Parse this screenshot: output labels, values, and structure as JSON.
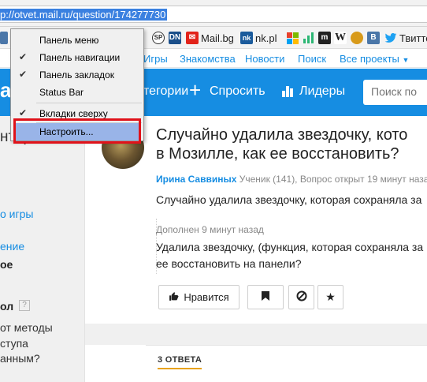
{
  "browser": {
    "url": "p://otvet.mail.ru/question/174277730"
  },
  "bookmarks": [
    {
      "icon": "sp-icon",
      "text": "SP",
      "color": "#333333"
    },
    {
      "icon": "dn-icon",
      "text": "DN",
      "color": "#1b4f8a"
    },
    {
      "icon": "mailbg-icon",
      "label": "Mail.bg",
      "color": "#e2231a"
    },
    {
      "icon": "nk-icon",
      "label": "nk.pl",
      "color": "#1b5b9c"
    },
    {
      "icon": "windows-icon",
      "color": "#e8412c"
    },
    {
      "icon": "m-icon",
      "text": "m",
      "color": "#222222"
    },
    {
      "icon": "wikipedia-icon",
      "text": "W",
      "color": "#444444"
    },
    {
      "icon": "coins-icon",
      "color": "#d89a1a"
    },
    {
      "icon": "vk-icon",
      "text": "B",
      "color": "#4a76a8"
    },
    {
      "icon": "twitter-icon",
      "label": "Твитте",
      "color": "#1da1f2"
    }
  ],
  "topnav": {
    "items": [
      "Игры",
      "Знакомства",
      "Новости",
      "Поиск",
      "Все проекты"
    ]
  },
  "header": {
    "categories": "тегории",
    "ask": "Спросить",
    "leaders": "Лидеры",
    "search_placeholder": "Поиск по"
  },
  "sidebar": {
    "line1": "нтересно?",
    "line2": "о игры",
    "line3": "ение",
    "line4": "ое",
    "line5": "ол",
    "line6": "от методы",
    "line7": "ступа",
    "line8": "анным?"
  },
  "question": {
    "title_line1": "Случайно удалила звездочку, кото",
    "title_line2": "в Мозилле, как ее восстановить?",
    "author": "Ирина Саввиных",
    "meta": " Ученик (141), Вопрос открыт 19 минут наза",
    "body": "Случайно удалила звездочку, которая сохраняла за",
    "added_label": "Дополнен 9 минут назад",
    "added_line1": "Удалила звездочку, (функция, которая сохраняла за",
    "added_line2": "ее восстановить на панели?"
  },
  "actions": {
    "like": "Нравится"
  },
  "answers": {
    "count_label": "3 ОТВЕТА"
  },
  "context_menu": {
    "items": [
      {
        "label": "Панель меню",
        "checked": false
      },
      {
        "label": "Панель навигации",
        "checked": true
      },
      {
        "label": "Панель закладок",
        "checked": true
      },
      {
        "label": "Status Bar",
        "checked": false
      },
      {
        "label": "Вкладки сверху",
        "checked": true
      },
      {
        "label": "Настроить...",
        "checked": false,
        "highlighted": true
      }
    ]
  },
  "colors": {
    "accent": "#168de2",
    "highlight_box": "#e0121a",
    "menu_selection": "#99b4e8"
  }
}
